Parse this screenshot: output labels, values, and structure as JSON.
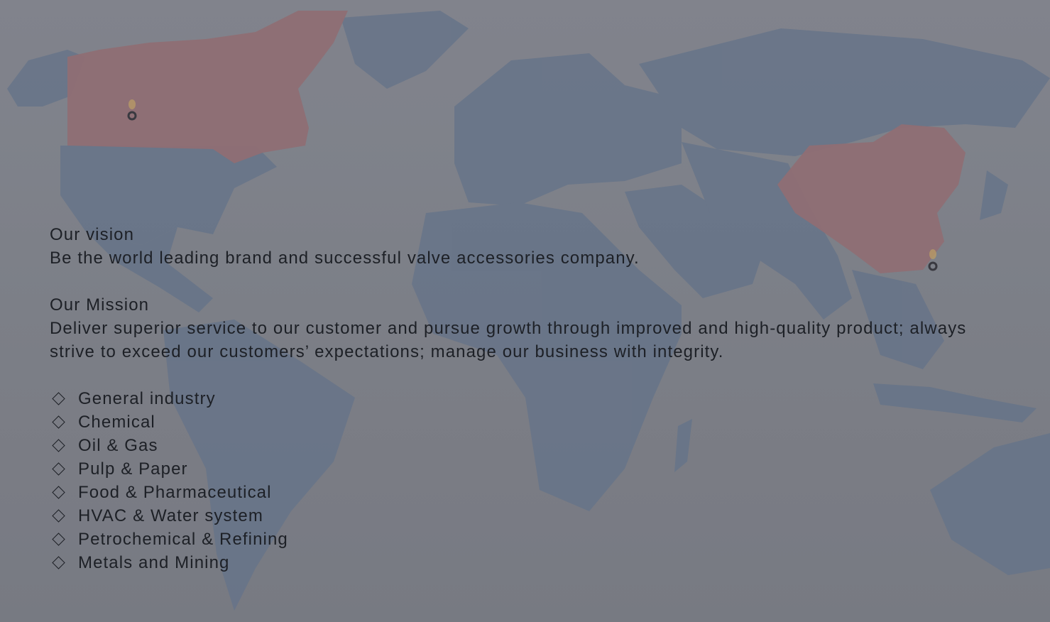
{
  "page": {
    "background_map": {
      "highlighted_regions": [
        "Canada",
        "China"
      ],
      "colors": {
        "background": "#868990",
        "land": "#6d7d92",
        "highlight": "#9b767a",
        "pin": "#c9a86a",
        "text": "#1d2026"
      }
    },
    "vision": {
      "heading": "Our vision",
      "text": "Be the world leading brand and successful valve accessories company."
    },
    "mission": {
      "heading": "Our Mission",
      "text": "Deliver superior service to our customer and pursue growth through improved and high-quality product; always strive to exceed our customers’ expectations; manage our business with integrity."
    },
    "industries": [
      {
        "label": "General industry"
      },
      {
        "label": "Chemical"
      },
      {
        "label": "Oil & Gas"
      },
      {
        "label": "Pulp & Paper"
      },
      {
        "label": "Food & Pharmaceutical"
      },
      {
        "label": "HVAC & Water system"
      },
      {
        "label": "Petrochemical & Refining"
      },
      {
        "label": "Metals and Mining"
      }
    ]
  }
}
